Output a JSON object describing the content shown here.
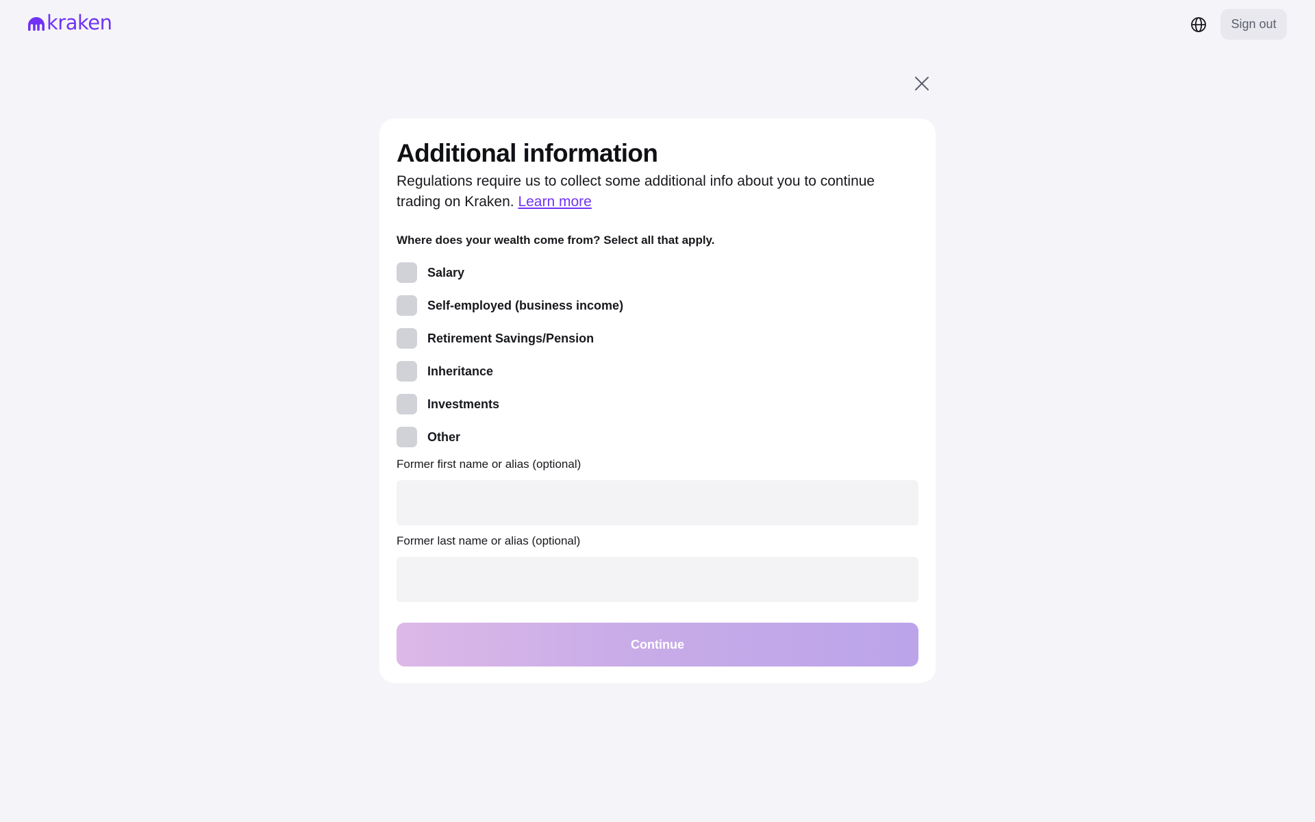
{
  "brand": {
    "logo_text": "kraken",
    "accent_color": "#7132f5",
    "logo_icon": "kraken-mark-icon"
  },
  "header": {
    "language_icon": "globe-icon",
    "sign_out_label": "Sign out"
  },
  "modal": {
    "close_icon": "close-icon",
    "title": "Additional information",
    "intro_text": "Regulations require us to collect some additional info about you to continue trading on Kraken.",
    "learn_more_label": "Learn more",
    "question": "Where does your wealth come from? Select all that apply.",
    "options": [
      {
        "label": "Salary",
        "checked": false
      },
      {
        "label": "Self-employed (business income)",
        "checked": false
      },
      {
        "label": "Retirement Savings/Pension",
        "checked": false
      },
      {
        "label": "Inheritance",
        "checked": false
      },
      {
        "label": "Investments",
        "checked": false
      },
      {
        "label": "Other",
        "checked": false
      }
    ],
    "first_name": {
      "label": "Former first name or alias (optional)",
      "value": "",
      "placeholder": ""
    },
    "last_name": {
      "label": "Former last name or alias (optional)",
      "value": "",
      "placeholder": ""
    },
    "continue_label": "Continue"
  }
}
